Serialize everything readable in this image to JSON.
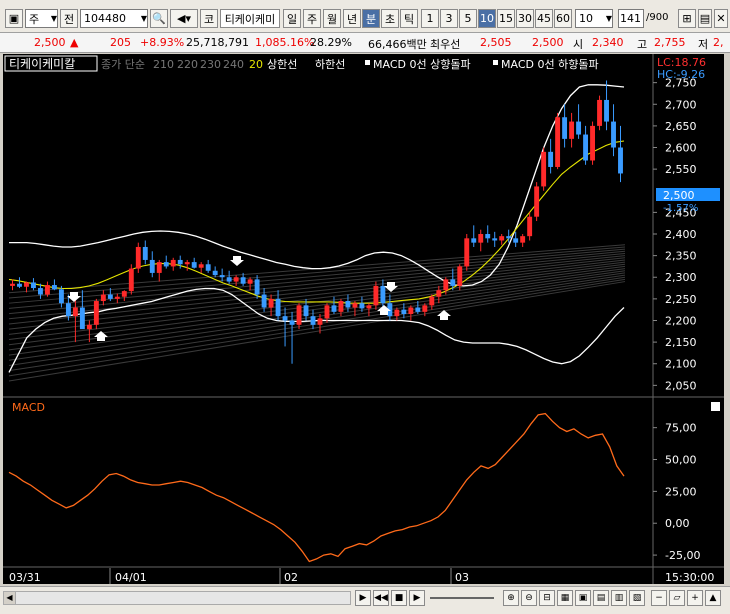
{
  "toolbar": {
    "market": "주",
    "jeon": "전",
    "code": "104480",
    "ko_btn": "코",
    "stock_name": "티케이케미",
    "periods": [
      "일",
      "주",
      "월",
      "년"
    ],
    "minute_btn": "분",
    "second_btn": "초",
    "tick_btn": "틱",
    "intervals": [
      "1",
      "3",
      "5",
      "10",
      "15",
      "30",
      "45",
      "60"
    ],
    "interval_selected": "10",
    "count_select": "10",
    "page_counter": "141",
    "page_total": "/900"
  },
  "quote": {
    "price": "2,500",
    "up_arrow": "▲",
    "change": "205",
    "change_pct": "+8.93%",
    "volume": "25,718,791",
    "volume_pct": "1,085.16%",
    "turnover": "28.29%",
    "amount": "66,466백만",
    "best_ask_label": "최우선",
    "best_ask": "2,505",
    "best_bid": "2,500",
    "open_label": "시",
    "open": "2,340",
    "high_label": "고",
    "high": "2,755",
    "low_label": "저",
    "low": "2,"
  },
  "legend": {
    "name": "티케이케미칼",
    "ma_label": "종가 단순",
    "ma_periods": [
      "210",
      "220",
      "230",
      "240"
    ],
    "ma20": "20",
    "upper": "상한선",
    "lower": "하한선",
    "macd_up": "MACD 0선 상향돌파",
    "macd_down": "MACD 0선 하향돌파",
    "lc": "LC:18.76",
    "hc": "HC:-9.26"
  },
  "price_axis": [
    "2,750",
    "2,700",
    "2,650",
    "2,600",
    "2,550",
    "2,450",
    "2,400",
    "2,350",
    "2,300",
    "2,250",
    "2,200",
    "2,150",
    "2,100",
    "2,050"
  ],
  "current_price_tag": "2,500",
  "current_pct_tag": "-1.57%",
  "macd_title": "MACD",
  "macd_axis": [
    "75,00",
    "50,00",
    "25,00",
    "0,00",
    "-25,00"
  ],
  "date_axis": [
    "03/31",
    "04/01",
    "02",
    "03"
  ],
  "time_label": "15:30:00",
  "colors": {
    "up": "#ff2a2a",
    "down": "#3a9bff",
    "band": "#ffffff",
    "ma20": "#e6e600",
    "macd": "#ff6a1a",
    "price_tag": "#1e90ff"
  },
  "chart_data": {
    "type": "candlestick",
    "price_range": [
      2030,
      2770
    ],
    "macd_range": [
      -32,
      92
    ],
    "candles": [
      [
        2280,
        2295,
        2270,
        2285
      ],
      [
        2285,
        2300,
        2275,
        2278
      ],
      [
        2278,
        2290,
        2265,
        2288
      ],
      [
        2288,
        2298,
        2270,
        2275
      ],
      [
        2275,
        2285,
        2250,
        2260
      ],
      [
        2260,
        2290,
        2255,
        2282
      ],
      [
        2282,
        2295,
        2270,
        2272
      ],
      [
        2272,
        2280,
        2230,
        2240
      ],
      [
        2240,
        2260,
        2200,
        2210
      ],
      [
        2210,
        2250,
        2150,
        2230
      ],
      [
        2230,
        2270,
        2200,
        2180
      ],
      [
        2180,
        2200,
        2150,
        2190
      ],
      [
        2190,
        2250,
        2180,
        2245
      ],
      [
        2245,
        2270,
        2235,
        2260
      ],
      [
        2260,
        2275,
        2245,
        2250
      ],
      [
        2250,
        2262,
        2240,
        2255
      ],
      [
        2255,
        2270,
        2245,
        2268
      ],
      [
        2268,
        2330,
        2260,
        2320
      ],
      [
        2320,
        2380,
        2310,
        2370
      ],
      [
        2370,
        2385,
        2330,
        2340
      ],
      [
        2340,
        2360,
        2300,
        2310
      ],
      [
        2310,
        2340,
        2290,
        2335
      ],
      [
        2335,
        2350,
        2320,
        2325
      ],
      [
        2325,
        2345,
        2315,
        2340
      ],
      [
        2340,
        2350,
        2320,
        2330
      ],
      [
        2330,
        2340,
        2315,
        2335
      ],
      [
        2335,
        2345,
        2320,
        2322
      ],
      [
        2322,
        2335,
        2310,
        2330
      ],
      [
        2330,
        2340,
        2310,
        2315
      ],
      [
        2315,
        2325,
        2300,
        2305
      ],
      [
        2305,
        2320,
        2290,
        2300
      ],
      [
        2300,
        2315,
        2285,
        2290
      ],
      [
        2290,
        2305,
        2280,
        2300
      ],
      [
        2300,
        2310,
        2280,
        2285
      ],
      [
        2285,
        2300,
        2270,
        2295
      ],
      [
        2295,
        2305,
        2250,
        2260
      ],
      [
        2260,
        2275,
        2220,
        2230
      ],
      [
        2230,
        2260,
        2210,
        2250
      ],
      [
        2250,
        2270,
        2200,
        2210
      ],
      [
        2210,
        2230,
        2140,
        2200
      ],
      [
        2200,
        2220,
        2100,
        2190
      ],
      [
        2190,
        2240,
        2180,
        2235
      ],
      [
        2235,
        2250,
        2200,
        2210
      ],
      [
        2210,
        2225,
        2180,
        2190
      ],
      [
        2190,
        2215,
        2170,
        2205
      ],
      [
        2205,
        2240,
        2195,
        2235
      ],
      [
        2235,
        2255,
        2215,
        2220
      ],
      [
        2220,
        2250,
        2210,
        2245
      ],
      [
        2245,
        2260,
        2220,
        2230
      ],
      [
        2230,
        2245,
        2210,
        2240
      ],
      [
        2240,
        2255,
        2220,
        2228
      ],
      [
        2228,
        2240,
        2210,
        2235
      ],
      [
        2235,
        2290,
        2225,
        2280
      ],
      [
        2280,
        2295,
        2230,
        2240
      ],
      [
        2240,
        2260,
        2200,
        2210
      ],
      [
        2210,
        2230,
        2200,
        2225
      ],
      [
        2225,
        2240,
        2205,
        2215
      ],
      [
        2215,
        2235,
        2200,
        2230
      ],
      [
        2230,
        2245,
        2215,
        2220
      ],
      [
        2220,
        2240,
        2210,
        2235
      ],
      [
        2235,
        2260,
        2225,
        2255
      ],
      [
        2255,
        2280,
        2240,
        2270
      ],
      [
        2270,
        2300,
        2260,
        2295
      ],
      [
        2295,
        2320,
        2270,
        2280
      ],
      [
        2280,
        2330,
        2270,
        2325
      ],
      [
        2325,
        2400,
        2315,
        2390
      ],
      [
        2390,
        2420,
        2370,
        2380
      ],
      [
        2380,
        2410,
        2360,
        2400
      ],
      [
        2400,
        2420,
        2380,
        2390
      ],
      [
        2390,
        2405,
        2370,
        2385
      ],
      [
        2385,
        2400,
        2375,
        2395
      ],
      [
        2395,
        2410,
        2380,
        2390
      ],
      [
        2390,
        2405,
        2370,
        2380
      ],
      [
        2380,
        2400,
        2370,
        2395
      ],
      [
        2395,
        2450,
        2385,
        2440
      ],
      [
        2440,
        2520,
        2430,
        2510
      ],
      [
        2510,
        2600,
        2500,
        2590
      ],
      [
        2590,
        2620,
        2540,
        2555
      ],
      [
        2555,
        2680,
        2550,
        2670
      ],
      [
        2670,
        2700,
        2600,
        2620
      ],
      [
        2620,
        2680,
        2600,
        2660
      ],
      [
        2660,
        2700,
        2620,
        2630
      ],
      [
        2630,
        2650,
        2560,
        2570
      ],
      [
        2570,
        2660,
        2560,
        2650
      ],
      [
        2650,
        2720,
        2640,
        2710
      ],
      [
        2710,
        2755,
        2640,
        2660
      ],
      [
        2660,
        2700,
        2580,
        2600
      ],
      [
        2600,
        2650,
        2520,
        2540
      ]
    ],
    "bb_upper": [
      2380,
      2380,
      2380,
      2378,
      2375,
      2372,
      2370,
      2370,
      2372,
      2376,
      2380,
      2385,
      2390,
      2395,
      2400,
      2404,
      2406,
      2407,
      2406,
      2404,
      2400,
      2395,
      2388,
      2380,
      2372,
      2365,
      2358,
      2352,
      2346,
      2340,
      2334,
      2330,
      2325,
      2322,
      2320,
      2320,
      2322,
      2326,
      2332,
      2340,
      2350,
      2356,
      2358,
      2356,
      2350,
      2340,
      2328,
      2315,
      2302,
      2290,
      2282,
      2280,
      2282,
      2290,
      2305,
      2330,
      2370,
      2420,
      2480,
      2540,
      2600,
      2650,
      2690,
      2720,
      2740,
      2745,
      2745,
      2744,
      2742,
      2740
    ],
    "bb_lower": [
      2080,
      2120,
      2160,
      2180,
      2195,
      2205,
      2210,
      2212,
      2215,
      2218,
      2220,
      2225,
      2228,
      2232,
      2236,
      2240,
      2244,
      2250,
      2256,
      2262,
      2268,
      2272,
      2274,
      2274,
      2270,
      2260,
      2245,
      2230,
      2215,
      2205,
      2200,
      2198,
      2198,
      2198,
      2199,
      2200,
      2200,
      2200,
      2200,
      2200,
      2200,
      2200,
      2200,
      2200,
      2200,
      2198,
      2195,
      2188,
      2178,
      2166,
      2155,
      2150,
      2148,
      2148,
      2148,
      2148,
      2145,
      2140,
      2132,
      2122,
      2112,
      2104,
      2100,
      2105,
      2118,
      2138,
      2160,
      2185,
      2210,
      2230
    ],
    "ma20": [
      2295,
      2292,
      2288,
      2284,
      2280,
      2276,
      2274,
      2274,
      2276,
      2280,
      2286,
      2294,
      2303,
      2312,
      2320,
      2326,
      2330,
      2332,
      2331,
      2328,
      2322,
      2314,
      2305,
      2296,
      2287,
      2280,
      2272,
      2264,
      2256,
      2250,
      2246,
      2244,
      2243,
      2243,
      2243,
      2243,
      2243,
      2242,
      2240,
      2240,
      2240,
      2240,
      2242,
      2244,
      2246,
      2248,
      2250,
      2254,
      2260,
      2268,
      2278,
      2290,
      2305,
      2322,
      2342,
      2364,
      2388,
      2414,
      2440,
      2465,
      2490,
      2515,
      2538,
      2555,
      2570,
      2585,
      2595,
      2605,
      2612,
      2615
    ],
    "macd": [
      40,
      37,
      33,
      30,
      26,
      22,
      18,
      15,
      12,
      14,
      18,
      22,
      27,
      33,
      38,
      39,
      37,
      34,
      32,
      31,
      30,
      30,
      31,
      32,
      33,
      32,
      30,
      28,
      25,
      22,
      20,
      17,
      14,
      11,
      8,
      5,
      2,
      -1,
      -5,
      -10,
      -15,
      -22,
      -30,
      -28,
      -25,
      -24,
      -26,
      -20,
      -18,
      -16,
      -17,
      -14,
      -10,
      -8,
      -6,
      -5,
      -3,
      -2,
      0,
      2,
      5,
      10,
      18,
      26,
      34,
      40,
      45,
      43,
      46,
      52,
      58,
      64,
      70,
      78,
      85,
      86,
      80,
      75,
      72,
      74,
      70,
      67,
      69,
      70,
      60,
      45,
      37
    ]
  }
}
